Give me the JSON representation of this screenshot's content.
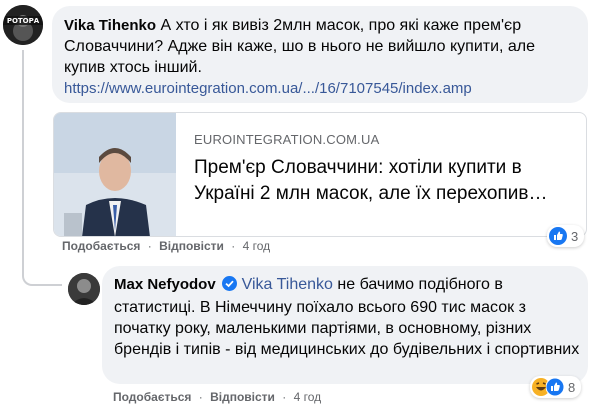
{
  "comment1": {
    "author": "Vika Tihenko",
    "text": "А хто і як вивіз 2млн масок, про які каже прем'єр Словаччини? Адже він каже, шо в нього не вийшло купити, але купив хтось інший.",
    "link": "https://www.eurointegration.com.ua/.../16/7107545/index.amp",
    "avatar_text": "РОТОРА",
    "card": {
      "domain": "EUROINTEGRATION.COM.UA",
      "title": "Прем'єр Словаччини: хотіли купити в Україні 2 млн масок, але їх перехопив…"
    },
    "actions": {
      "like": "Подобається",
      "reply": "Відповісти",
      "time": "4 год"
    },
    "reactions": {
      "count": "3",
      "icon": "like-reaction-icon",
      "color": "#1877f2"
    }
  },
  "comment2": {
    "author": "Max Nefyodov",
    "verified_icon": "verified-badge-icon",
    "mention": "Vika Tihenko",
    "text": " не бачимо подібного в статистиці. В Німеччину поїхало всього 690 тис масок з початку року, маленькими партіями, в основному, різних брендів і типів - від медицинських до будівельних і спортивних",
    "actions": {
      "like": "Подобається",
      "reply": "Відповісти",
      "time": "4 год"
    },
    "reactions": {
      "count": "8",
      "icons": [
        "haha-reaction-icon",
        "like-reaction-icon"
      ]
    }
  }
}
